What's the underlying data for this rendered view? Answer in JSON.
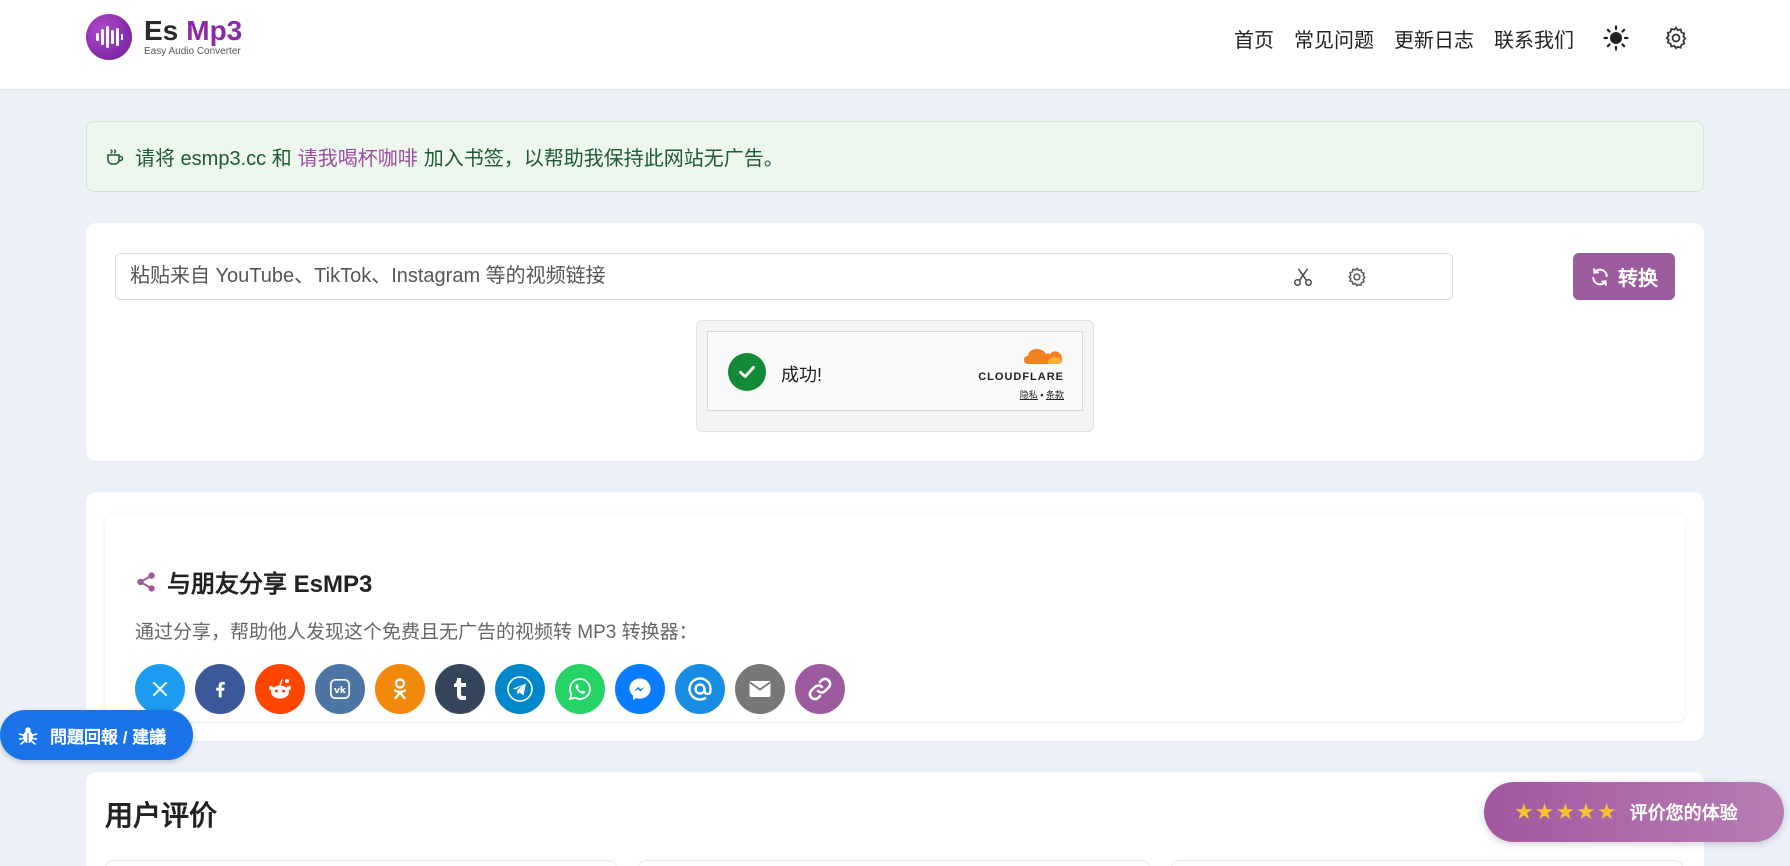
{
  "header": {
    "logo_es": "Es",
    "logo_mp3": "Mp3",
    "logo_sub": "Easy Audio Converter",
    "nav": [
      "首页",
      "常见问题",
      "更新日志",
      "联系我们"
    ],
    "theme_icon": "sun-icon",
    "settings_icon": "gear-icon"
  },
  "notice": {
    "prefix": "请将 esmp3.cc 和",
    "link": "请我喝杯咖啡",
    "suffix": "加入书签，以帮助我保持此网站无广告。"
  },
  "converter": {
    "placeholder": "粘贴来自 YouTube、TikTok、Instagram 等的视频链接",
    "value": "",
    "convert_label": "转换"
  },
  "captcha": {
    "status": "成功!",
    "brand": "CLOUDFLARE",
    "privacy": "隐私",
    "separator": "•",
    "terms": "条款"
  },
  "share": {
    "title": "与朋友分享 EsMP3",
    "description": "通过分享，帮助他人发现这个免费且无广告的视频转 MP3 转换器：",
    "networks": [
      {
        "name": "x",
        "color": "#1d9bf0"
      },
      {
        "name": "facebook",
        "color": "#3b5998"
      },
      {
        "name": "reddit",
        "color": "#ff4500"
      },
      {
        "name": "vk",
        "color": "#4c75a3"
      },
      {
        "name": "odnoklassniki",
        "color": "#f2880c"
      },
      {
        "name": "tumblr",
        "color": "#35465c"
      },
      {
        "name": "telegram",
        "color": "#0088cc"
      },
      {
        "name": "whatsapp",
        "color": "#25d366"
      },
      {
        "name": "messenger",
        "color": "#0a7cff"
      },
      {
        "name": "mail-at",
        "color": "#168de2"
      },
      {
        "name": "email",
        "color": "#777777"
      },
      {
        "name": "copy-link",
        "color": "#9c5b9e"
      }
    ]
  },
  "reviews": {
    "title": "用户评价"
  },
  "feedback": {
    "label": "問題回報 / 建議"
  },
  "rate": {
    "stars": "★★★★★",
    "label": "评价您的体验"
  }
}
